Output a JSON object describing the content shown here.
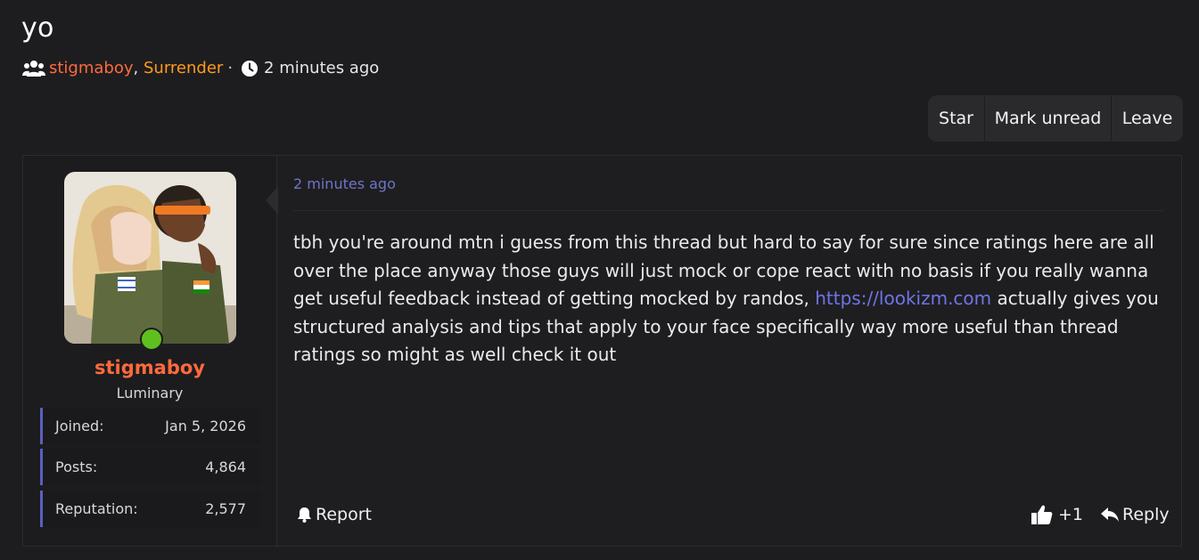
{
  "thread": {
    "title": "yo",
    "participants": [
      {
        "name": "stigmaboy",
        "color": "#ff6a3d"
      },
      {
        "name": "Surrender",
        "color": "#ff9a1f"
      }
    ],
    "participant_separator": ",",
    "meta_dot": "·",
    "time": "2 minutes ago"
  },
  "toolbar": {
    "star_label": "Star",
    "mark_unread_label": "Mark unread",
    "leave_label": "Leave"
  },
  "post": {
    "time": "2 minutes ago",
    "text_before_link": "tbh you're around mtn i guess from this thread but hard to say for sure since ratings here are all over the place anyway those guys will just mock or cope react with no basis if you really wanna get useful feedback instead of getting mocked by randos, ",
    "link_text": "https://lookizm.com",
    "text_after_link": " actually gives you structured analysis and tips that apply to your face specifically way more useful than thread ratings so might as well check it out",
    "report_label": "Report",
    "like_count": "+1",
    "reply_label": "Reply"
  },
  "author": {
    "name": "stigmaboy",
    "rank": "Luminary",
    "online": true,
    "stats": [
      {
        "label": "Joined:",
        "value": "Jan 5, 2026"
      },
      {
        "label": "Posts:",
        "value": "4,864"
      },
      {
        "label": "Reputation:",
        "value": "2,577"
      }
    ]
  },
  "colors": {
    "background": "#1d1d1f",
    "accent_link": "#6f74e8",
    "online": "#5fbf1f",
    "stat_border": "#5b5fbf"
  },
  "icons": [
    "users-icon",
    "clock-icon",
    "bell-icon",
    "thumbs-up-icon",
    "reply-icon"
  ]
}
